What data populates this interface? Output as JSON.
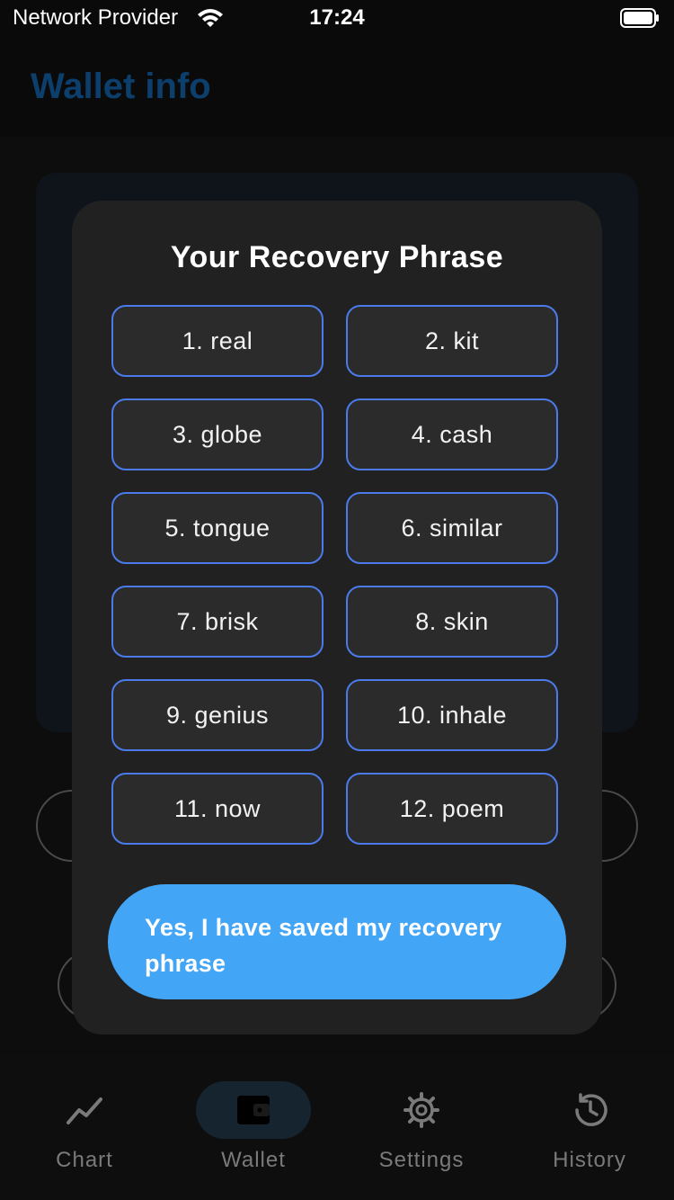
{
  "status_bar": {
    "carrier": "Network Provider",
    "time": "17:24",
    "icons": [
      "wifi-icon",
      "battery-icon"
    ]
  },
  "header": {
    "title": "Wallet info"
  },
  "colors": {
    "accent": "#42a5f5",
    "word_border": "#4b7bea",
    "modal_bg": "#212121",
    "title_blue": "#0d3f6d"
  },
  "recovery_dialog": {
    "title": "Your Recovery Phrase",
    "words": [
      "1. real",
      "2. kit",
      "3. globe",
      "4. cash",
      "5. tongue",
      "6. similar",
      "7. brisk",
      "8. skin",
      "9. genius",
      "10. inhale",
      "11. now",
      "12. poem"
    ],
    "confirm_line1": "Yes, I have saved my recovery",
    "confirm_line2": "phrase"
  },
  "bottom_nav": {
    "items": [
      {
        "label": "Chart",
        "icon": "chart-line-icon",
        "active": false
      },
      {
        "label": "Wallet",
        "icon": "wallet-icon",
        "active": true
      },
      {
        "label": "Settings",
        "icon": "gear-icon",
        "active": false
      },
      {
        "label": "History",
        "icon": "history-icon",
        "active": false
      }
    ]
  }
}
